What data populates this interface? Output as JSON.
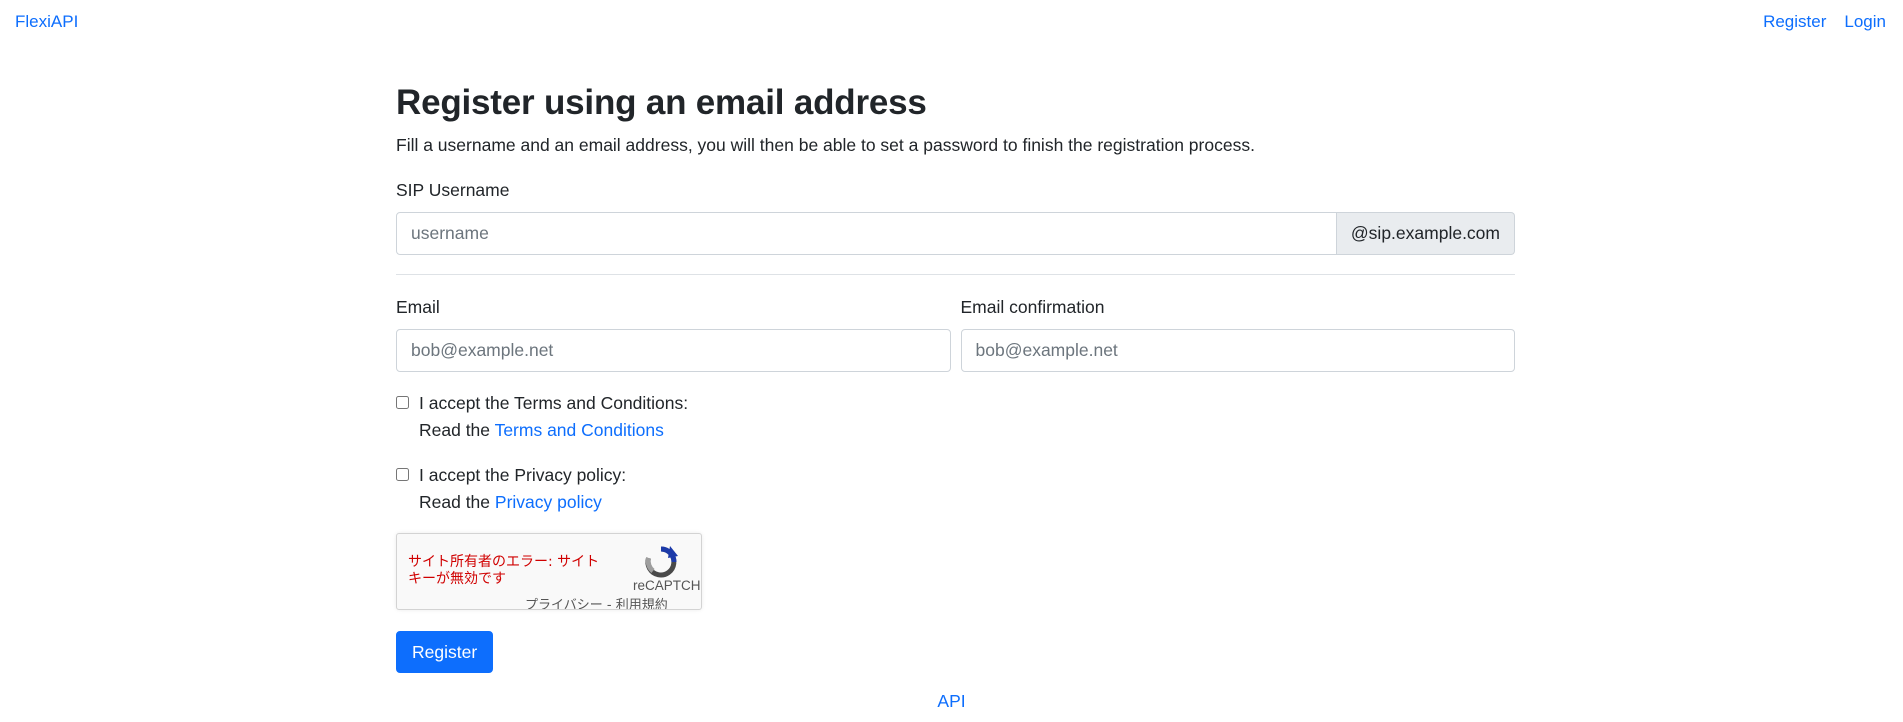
{
  "header": {
    "brand": "FlexiAPI",
    "nav": {
      "register": "Register",
      "login": "Login"
    }
  },
  "main": {
    "title": "Register using an email address",
    "description": "Fill a username and an email address, you will then be able to set a password to finish the registration process.",
    "sip": {
      "label": "SIP Username",
      "placeholder": "username",
      "value": "",
      "domain_suffix": "@sip.example.com"
    },
    "email": {
      "label": "Email",
      "placeholder": "bob@example.net",
      "value": ""
    },
    "email_confirmation": {
      "label": "Email confirmation",
      "placeholder": "bob@example.net",
      "value": ""
    },
    "terms": {
      "checked": false,
      "label": "I accept the Terms and Conditions:",
      "read_prefix": "Read the",
      "link_text": "Terms and Conditions"
    },
    "privacy": {
      "checked": false,
      "label": "I accept the Privacy policy:",
      "read_prefix": "Read the",
      "link_text": "Privacy policy"
    },
    "recaptcha": {
      "error": "サイト所有者のエラー: サイトキーが無効です",
      "brand": "reCAPTCH",
      "privacy_link": "プライバシー",
      "separator": " - ",
      "terms_link": "利用規約",
      "error_color": "#d00000"
    },
    "submit_label": "Register"
  },
  "footer": {
    "api_link": "API"
  },
  "colors": {
    "link": "#0d6efd",
    "primary_button": "#0d6efd",
    "text": "#212529",
    "input_border": "#ced4da",
    "addon_background": "#e9ecef"
  }
}
